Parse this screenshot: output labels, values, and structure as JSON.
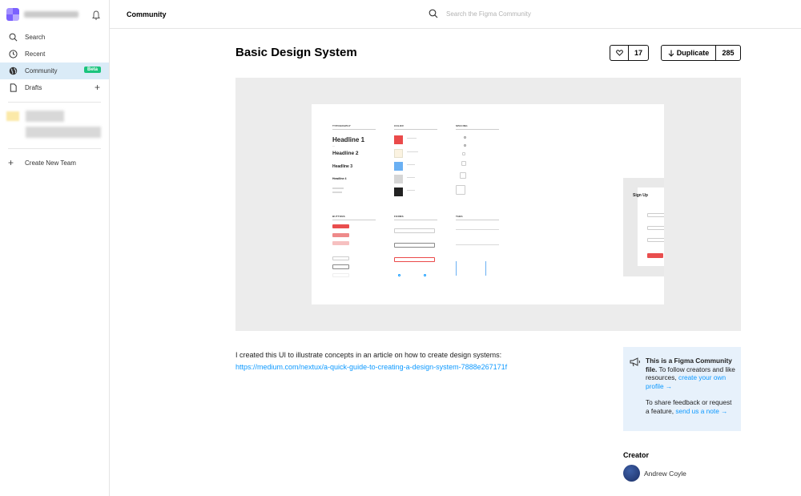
{
  "sidebar": {
    "items": [
      {
        "label": "Search",
        "icon": "search-icon"
      },
      {
        "label": "Recent",
        "icon": "clock-icon"
      },
      {
        "label": "Community",
        "icon": "globe-icon",
        "badge": "Beta",
        "active": true
      },
      {
        "label": "Drafts",
        "icon": "file-icon"
      }
    ],
    "create_team": "Create New Team"
  },
  "header": {
    "title": "Community",
    "search_placeholder": "Search the Figma Community"
  },
  "file": {
    "title": "Basic Design System",
    "likes": "17",
    "duplicate_label": "Duplicate",
    "duplicates": "285"
  },
  "preview": {
    "sections": {
      "typography": "TYPOGRAPHY",
      "color": "COLOR",
      "spacing": "SPACING",
      "buttons": "BUTTONS",
      "forms": "FORMS",
      "tabs": "TABS"
    },
    "headlines": [
      "Headline 1",
      "Headline 2",
      "Headline 3",
      "Headline 4"
    ],
    "signup_title": "Sign Up",
    "swatch_colors": [
      "#ea4a4a",
      "#fbf3e1",
      "#6ab0f3",
      "#d6d6d6",
      "#222222"
    ]
  },
  "description": {
    "text": "I created this UI to illustrate concepts in an article on how to create design systems:",
    "link": "https://medium.com/nextux/a-quick-guide-to-creating-a-design-system-7888e267171f"
  },
  "info": {
    "bold": "This is a Figma Community file.",
    "text1": " To follow creators and like resources, ",
    "link1": "create your own profile →",
    "text2": "To share feedback or request a feature, ",
    "link2": "send us a note →"
  },
  "creator": {
    "heading": "Creator",
    "name": "Andrew Coyle"
  },
  "colors": {
    "accent": "#0d99ff",
    "active_nav": "#daebf7",
    "badge": "#1bc47d",
    "info_bg": "#e7f1fb"
  }
}
